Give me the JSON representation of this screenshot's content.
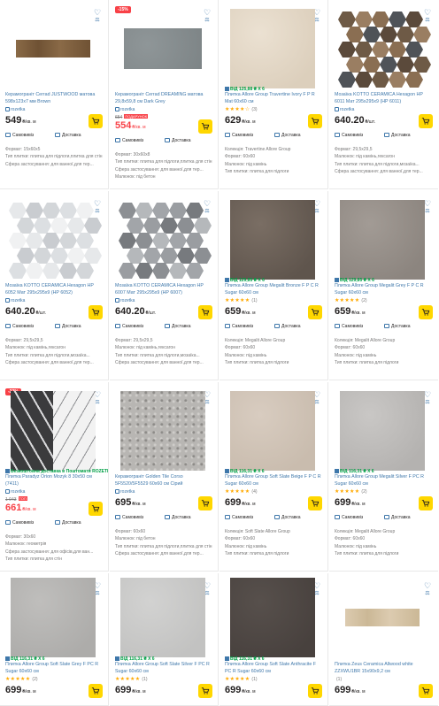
{
  "ui": {
    "accent": "#3e77aa",
    "sale_color": "#f84147",
    "cart_color": "#ffd700",
    "star_color": "#ffa900",
    "green": "#00a046",
    "price_unit_m2": "₴/кв. м",
    "price_unit_pc": "₴/шт."
  },
  "products": [
    {
      "badge": "",
      "promo": "",
      "title": "Керамограніт Cerrad JUSTWOOD матова 598x123x7 мм Brown",
      "rating": "",
      "reviews": "",
      "seller": "rozetka",
      "old_price": "",
      "price_tag": "",
      "price": "549",
      "unit": "₴/кв. м",
      "price_red": false,
      "delivery": [
        "Самовивіз",
        "Доставка"
      ],
      "specs": [
        "Формат: 15x60x5",
        "Тип плитки: плитка для підлоги,плитка для стін",
        "Сфера застосування: для ванної,для тер..."
      ],
      "image": {
        "kind": "plank",
        "colors": [
          "#8a6a47",
          "#6f5234"
        ]
      }
    },
    {
      "badge": "-15%",
      "promo": "",
      "title": "Керамограніт Cerrad DREAMING матова 29,8x59,8 см Dark Grey",
      "rating": "",
      "reviews": "",
      "seller": "rozetka",
      "old_price": "654",
      "price_tag": "ПОДАРУНОК",
      "price": "554",
      "unit": "₴/кв. м",
      "price_red": true,
      "delivery": [
        "Самовивіз",
        "Доставка"
      ],
      "specs": [
        "Формат: 30x60x8",
        "Тип плитки: плитка для підлоги,плитка для стін",
        "Сфера застосування: для ванної,для тер...",
        "Малюнок: під бетон"
      ],
      "image": {
        "kind": "slab",
        "colors": [
          "#8f9698",
          "#7d8486"
        ]
      }
    },
    {
      "badge": "",
      "promo": "ВІД 125,88 ₴ Х 6",
      "title": "Плитка Allore Group Travertine Ivory F P R Mat 60x60 см",
      "rating": "★★★★☆",
      "reviews": "(3)",
      "seller": "",
      "old_price": "",
      "price_tag": "",
      "price": "629",
      "unit": "₴/кв. м",
      "price_red": false,
      "delivery": [
        "Самовивіз",
        "Доставка"
      ],
      "specs": [
        "Колекція: Travertine Allore Group",
        "Формат: 60x60",
        "Малюнок: під камінь",
        "Тип плитки: плитка для підлоги"
      ],
      "image": {
        "kind": "square",
        "colors": [
          "#ebe1d2",
          "#dccfbc"
        ]
      }
    },
    {
      "badge": "",
      "promo": "",
      "title": "Мозаїка KOTTO CERAMICA Hexagon HP 6011 Мат 295x295x9 (HP 6011)",
      "rating": "",
      "reviews": "",
      "seller": "rozetka",
      "old_price": "",
      "price_tag": "",
      "price": "640.20",
      "unit": "₴/шт.",
      "price_red": false,
      "delivery": [
        "Самовивіз",
        "Доставка"
      ],
      "specs": [
        "Формат: 29,5x29,5",
        "Малюнок: під камінь,гексагон",
        "Тип плитки: плитка для підлоги,мозаїка...",
        "Сфера застосування: для ванної,для тер..."
      ],
      "image": {
        "kind": "hex",
        "colors": [
          "#6e5a46",
          "#8a6e52",
          "#5b4a3b",
          "#9a7e62",
          "#4f5358"
        ]
      }
    },
    {
      "badge": "",
      "promo": "",
      "title": "Мозаїка KOTTO CERAMICA Hexagon HP 6052 Мат 295x295x9 (HP 6052)",
      "rating": "",
      "reviews": "",
      "seller": "rozetka",
      "old_price": "",
      "price_tag": "",
      "price": "640.20",
      "unit": "₴/шт.",
      "price_red": false,
      "delivery": [
        "Самовивіз",
        "Доставка"
      ],
      "specs": [
        "Формат: 29,5x29,5",
        "Малюнок: під камінь,гексагон",
        "Тип плитки: плитка для підлоги,мозаїка...",
        "Сфера застосування: для ванної,для тер..."
      ],
      "image": {
        "kind": "hex",
        "colors": [
          "#e6e8ea",
          "#d3d6d9",
          "#f0f1f2",
          "#c9ccd0",
          "#dcdfe2"
        ]
      }
    },
    {
      "badge": "",
      "promo": "",
      "title": "Мозаїка KOTTO CERAMICA Hexagon HP 6007 Мат 295x295x9 (HP 6007)",
      "rating": "",
      "reviews": "",
      "seller": "rozetka",
      "old_price": "",
      "price_tag": "",
      "price": "640.20",
      "unit": "₴/шт.",
      "price_red": false,
      "delivery": [
        "Самовивіз",
        "Доставка"
      ],
      "specs": [
        "Формат: 29,5x29,5",
        "Малюнок: під камінь,гексагон",
        "Тип плитки: плитка для підлоги,мозаїка...",
        "Сфера застосування: для ванної,для тер..."
      ],
      "image": {
        "kind": "hex",
        "colors": [
          "#8c8f93",
          "#a2a5a9",
          "#777a7e",
          "#b5b8bb",
          "#9a9da1"
        ]
      }
    },
    {
      "badge": "",
      "promo": "ВІД 129,85 ₴ Х 6",
      "title": "Плитка Allore Group Megalit Bronze F P C R Sugar 60x60 см",
      "rating": "★★★★★",
      "reviews": "(1)",
      "seller": "",
      "old_price": "",
      "price_tag": "",
      "price": "659",
      "unit": "₴/кв. м",
      "price_red": false,
      "delivery": [
        "Самовивіз",
        "Доставка"
      ],
      "specs": [
        "Колекція: Megalit Allore Group",
        "Формат: 60x60",
        "Малюнок: під камінь",
        "Тип плитки: плитка для підлоги"
      ],
      "image": {
        "kind": "square",
        "colors": [
          "#7a6e64",
          "#5f554d"
        ]
      }
    },
    {
      "badge": "",
      "promo": "ВІД 129,85 ₴ Х 6",
      "title": "Плитка Allore Group Megalit Grey F P C R Sugar 60x60 см",
      "rating": "★★★★★",
      "reviews": "(2)",
      "seller": "",
      "old_price": "",
      "price_tag": "",
      "price": "659",
      "unit": "₴/кв. м",
      "price_red": false,
      "delivery": [
        "Самовивіз",
        "Доставка"
      ],
      "specs": [
        "Колекція: Megalit Allore Group",
        "Формат: 60x60",
        "Малюнок: під камінь",
        "Тип плитки: плитка для підлоги"
      ],
      "image": {
        "kind": "square",
        "colors": [
          "#a29b95",
          "#8c857f"
        ]
      }
    },
    {
      "badge": "-22%",
      "promo": "Безкоштовна доставка в Поштомати ROZETKA",
      "title": "Плитка Paradyz Orion Mozyk 8 30x50 см (7411)",
      "rating": "",
      "reviews": "",
      "seller": "rozetka",
      "old_price": "1 043",
      "price_tag": "ТОП",
      "price": "661",
      "unit": "₴/кв. м",
      "price_red": true,
      "delivery": [
        "Самовивіз",
        "Доставка"
      ],
      "specs": [
        "Формат: 30x60",
        "Малюнок: геометрія",
        "Сфера застосування: для офісів,для ван...",
        "Тип плитки: плитка для стін"
      ],
      "image": {
        "kind": "geo",
        "colors": [
          "#3b3b3d",
          "#d9d9db",
          "#8e8f92"
        ]
      }
    },
    {
      "badge": "",
      "promo": "",
      "title": "Керамограніт Golden Tile Corso 5F5520/5F5529 60x60 см Сірий",
      "rating": "",
      "reviews": "",
      "seller": "rozetka",
      "old_price": "",
      "price_tag": "",
      "price": "695",
      "unit": "₴/кв. м",
      "price_red": false,
      "delivery": [
        "Самовивіз",
        "Доставка"
      ],
      "specs": [
        "Формат: 60x60",
        "Малюнок: під бетон",
        "Тип плитки: плитка для підлоги,плитка для стін",
        "Сфера застосування: для ванної,для тер..."
      ],
      "image": {
        "kind": "terrazzo",
        "colors": [
          "#b8b6b3",
          "#a6a4a1"
        ]
      }
    },
    {
      "badge": "",
      "promo": "ВІД 116,31 ₴ Х 6",
      "title": "Плитка Allore Group Soft Slate Beige F P C R Sugar 60x60 см",
      "rating": "★★★★★",
      "reviews": "(4)",
      "seller": "",
      "old_price": "",
      "price_tag": "",
      "price": "699",
      "unit": "₴/кв. м",
      "price_red": false,
      "delivery": [
        "Самовивіз",
        "Доставка"
      ],
      "specs": [
        "Колекція: Soft Slate Allore Group",
        "Формат: 60x60",
        "Малюнок: під камінь",
        "Тип плитки: плитка для підлоги"
      ],
      "image": {
        "kind": "square",
        "colors": [
          "#d8ccc0",
          "#c9bcae"
        ]
      }
    },
    {
      "badge": "",
      "promo": "ВІД 116,31 ₴ Х 6",
      "title": "Плитка Allore Group Megalit Silver F PC R Sugar 60x60 см",
      "rating": "★★★★★",
      "reviews": "(2)",
      "seller": "",
      "old_price": "",
      "price_tag": "",
      "price": "699",
      "unit": "₴/кв. м",
      "price_red": false,
      "delivery": [
        "Самовивіз",
        "Доставка"
      ],
      "specs": [
        "Колекція: Megalit Allore Group",
        "Формат: 60x60",
        "Малюнок: під камінь",
        "Тип плитки: плитка для підлоги"
      ],
      "image": {
        "kind": "square",
        "colors": [
          "#c9c7c5",
          "#b4b2b0"
        ]
      }
    },
    {
      "badge": "",
      "promo": "ВІД 116,31 ₴ Х 6",
      "title": "Плитка Allore Group Soft Slate Grey F PC R Sugar 60x60 см",
      "rating": "★★★★★",
      "reviews": "(2)",
      "seller": "",
      "old_price": "",
      "price_tag": "",
      "price": "699",
      "unit": "₴/кв. м",
      "price_red": false,
      "delivery": [],
      "specs": [],
      "image": {
        "kind": "square",
        "colors": [
          "#bfbebc",
          "#adacaa"
        ]
      }
    },
    {
      "badge": "",
      "promo": "ВІД 116,31 ₴ Х 6",
      "title": "Плитка Allore Group Soft Slate Silver F PC R Sugar 60x60 см",
      "rating": "★★★★★",
      "reviews": "(1)",
      "seller": "",
      "old_price": "",
      "price_tag": "",
      "price": "699",
      "unit": "₴/кв. м",
      "price_red": false,
      "delivery": [],
      "specs": [],
      "image": {
        "kind": "square",
        "colors": [
          "#d2d2d1",
          "#c2c2c1"
        ]
      }
    },
    {
      "badge": "",
      "promo": "ВІД 116,31 ₴ Х 6",
      "title": "Плитка Allore Group Soft Slate Anthracite F PC R Sugar 60x60 см",
      "rating": "★★★★★",
      "reviews": "(1)",
      "seller": "",
      "old_price": "",
      "price_tag": "",
      "price": "699",
      "unit": "₴/кв. м",
      "price_red": false,
      "delivery": [],
      "specs": [],
      "image": {
        "kind": "square",
        "colors": [
          "#57504c",
          "#48413e"
        ]
      }
    },
    {
      "badge": "",
      "promo": "",
      "title": "Плитка Zeus Ceramica Allwood white ZZXWU1BR 15x90x9,2 см",
      "rating": "",
      "reviews": "(1)",
      "seller": "",
      "old_price": "",
      "price_tag": "",
      "price": "699",
      "unit": "₴/кв. м",
      "price_red": false,
      "delivery": [],
      "specs": [],
      "image": {
        "kind": "plank",
        "colors": [
          "#dccbb0",
          "#cbb896"
        ]
      }
    }
  ]
}
